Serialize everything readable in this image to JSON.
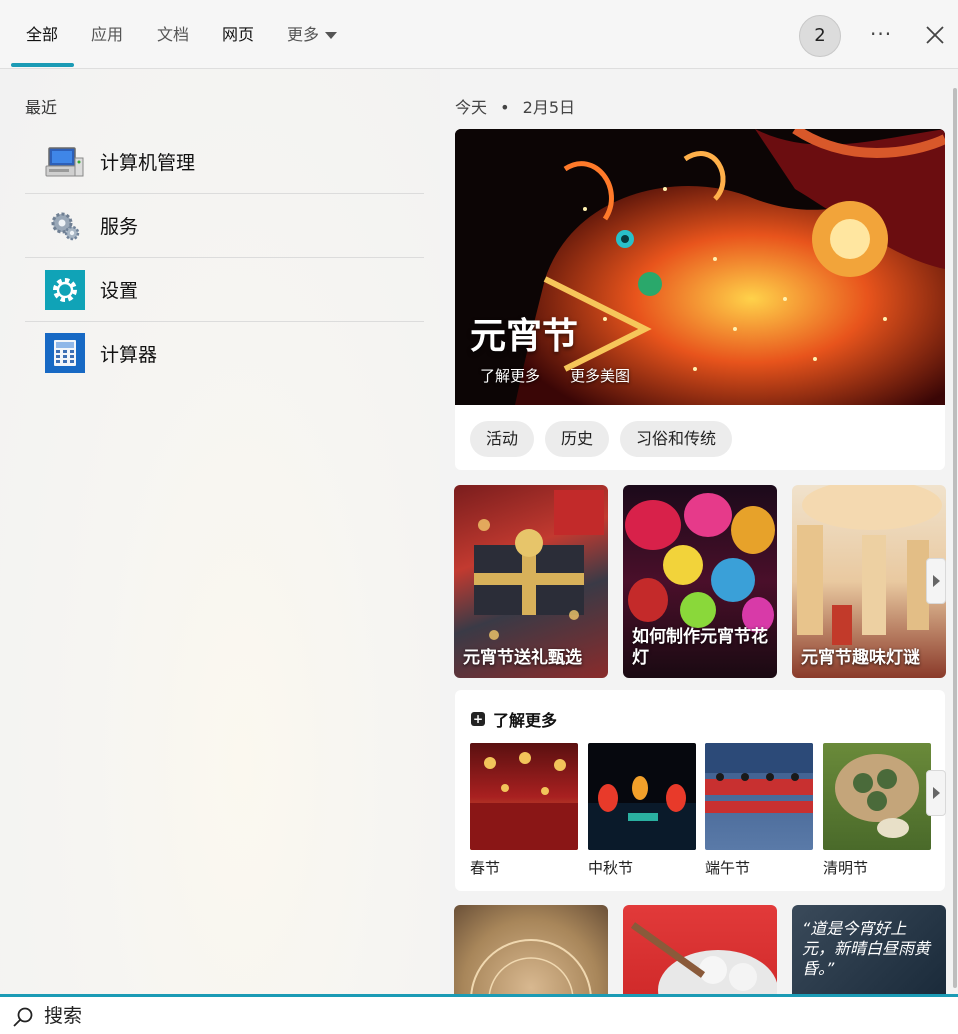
{
  "tabs": {
    "all": "全部",
    "apps": "应用",
    "docs": "文档",
    "web": "网页",
    "more": "更多"
  },
  "header": {
    "rewards_count": "2",
    "more_options_glyph": "···"
  },
  "recent": {
    "title": "最近",
    "items": [
      {
        "label": "计算机管理",
        "icon": "computer-management-icon"
      },
      {
        "label": "服务",
        "icon": "services-gear-icon"
      },
      {
        "label": "设置",
        "icon": "settings-gear-icon"
      },
      {
        "label": "计算器",
        "icon": "calculator-icon"
      }
    ]
  },
  "today": {
    "label": "今天",
    "separator": "•",
    "date": "2月5日"
  },
  "hero": {
    "title": "元宵节",
    "link_learn_more": "了解更多",
    "link_more_images": "更多美图",
    "chips": [
      "活动",
      "历史",
      "习俗和传统"
    ]
  },
  "cards": [
    {
      "label": "元宵节送礼甄选"
    },
    {
      "label": "如何制作元宵节花灯"
    },
    {
      "label": "元宵节趣味灯谜"
    }
  ],
  "learn_more": {
    "title": "了解更多",
    "items": [
      {
        "label": "春节"
      },
      {
        "label": "中秋节"
      },
      {
        "label": "端午节"
      },
      {
        "label": "清明节"
      }
    ]
  },
  "bottom_cards": {
    "quote": "“道是今宵好上元，新晴白昼雨黄昏。”"
  },
  "search": {
    "placeholder": "搜索"
  },
  "colors": {
    "accent": "#1b9bb5"
  }
}
